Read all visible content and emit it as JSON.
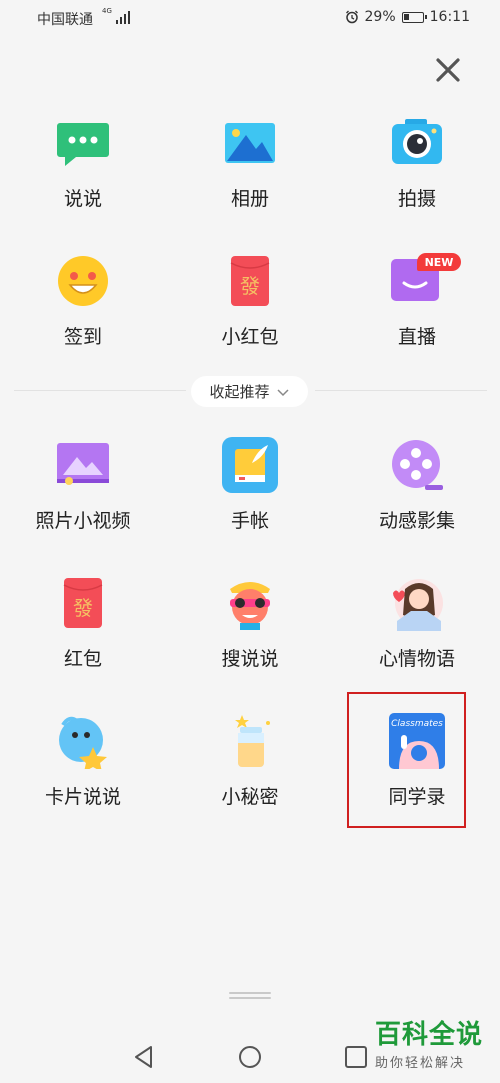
{
  "status_bar": {
    "carrier": "中国联通",
    "network": "4G",
    "battery": "29%",
    "time": "16:11"
  },
  "close": {
    "icon": "close-icon"
  },
  "top_items": [
    {
      "label": "说说",
      "icon": "chat-bubble-icon"
    },
    {
      "label": "相册",
      "icon": "photo-album-icon"
    },
    {
      "label": "拍摄",
      "icon": "camera-icon"
    },
    {
      "label": "签到",
      "icon": "smiley-checkin-icon"
    },
    {
      "label": "小红包",
      "icon": "red-envelope-icon"
    },
    {
      "label": "直播",
      "icon": "live-stream-icon",
      "badge": "NEW"
    }
  ],
  "collapse": {
    "label": "收起推荐"
  },
  "more_items": [
    {
      "label": "照片小视频",
      "icon": "photo-video-icon"
    },
    {
      "label": "手帐",
      "icon": "notebook-icon"
    },
    {
      "label": "动感影集",
      "icon": "film-reel-icon"
    },
    {
      "label": "红包",
      "icon": "red-envelope-icon"
    },
    {
      "label": "搜说说",
      "icon": "sunglasses-character-icon"
    },
    {
      "label": "心情物语",
      "icon": "girl-heart-icon"
    },
    {
      "label": "卡片说说",
      "icon": "bird-character-icon"
    },
    {
      "label": "小秘密",
      "icon": "secret-bottle-icon"
    },
    {
      "label": "同学录",
      "icon": "classmates-icon",
      "icon_text": "Classmates"
    }
  ],
  "watermark": {
    "title": "百科全说",
    "subtitle": "助你轻松解决"
  },
  "colors": {
    "highlight": "#d02020",
    "watermark": "#1f9a3a"
  }
}
